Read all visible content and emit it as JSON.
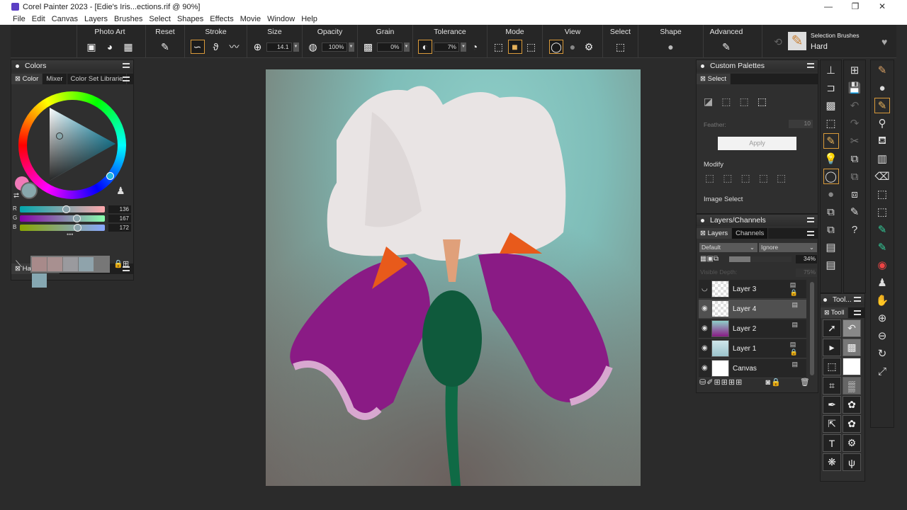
{
  "window": {
    "title": "Corel Painter 2023 - [Edie's Iris...ections.rif @ 90%]",
    "controls": [
      "minimize",
      "maximize",
      "close"
    ]
  },
  "menu": [
    "File",
    "Edit",
    "Canvas",
    "Layers",
    "Brushes",
    "Select",
    "Shapes",
    "Effects",
    "Movie",
    "Window",
    "Help"
  ],
  "toolbar": {
    "photo_art": "Photo Art",
    "reset": "Reset",
    "stroke": "Stroke",
    "size": "Size",
    "size_value": "14.1",
    "opacity": "Opacity",
    "opacity_value": "100%",
    "grain": "Grain",
    "grain_value": "0%",
    "tolerance": "Tolerance",
    "tolerance_value": "7%",
    "mode": "Mode",
    "view": "View",
    "select": "Select",
    "shape": "Shape",
    "advanced": "Advanced",
    "brush_category": "Selection Brushes",
    "brush_variant": "Hard"
  },
  "colors_panel": {
    "title": "Colors",
    "tabs": [
      "Color",
      "Mixer",
      "Color Set Librarie"
    ],
    "main_color": "#88a7ac",
    "secondary_color": "#f07ab8",
    "rgb": {
      "r_label": "R",
      "g_label": "G",
      "b_label": "B",
      "r": "136",
      "g": "167",
      "b": "172"
    },
    "harmonies_title": "Harmonies",
    "harmony_swatches": [
      "#a88a8a",
      "#a89090",
      "#9a9a9e",
      "#8fa3ab",
      "#86a8b2"
    ]
  },
  "custom_palettes": {
    "title": "Custom Palettes",
    "tab": "Select",
    "feather_label": "Feather:",
    "feather_value": "10",
    "apply": "Apply",
    "modify": "Modify",
    "image_select": "Image Select"
  },
  "layers_panel": {
    "title": "Layers/Channels",
    "tabs": [
      "Layers",
      "Channels"
    ],
    "composite_method": "Default",
    "preserve": "Ignore",
    "opacity": "34%",
    "visible_depth_label": "Visible Depth:",
    "visible_depth": "75%",
    "layers": [
      {
        "name": "Layer 3",
        "visible": false,
        "locked": true
      },
      {
        "name": "Layer 4",
        "visible": true,
        "locked": false,
        "selected": true
      },
      {
        "name": "Layer 2",
        "visible": true,
        "locked": false
      },
      {
        "name": "Layer 1",
        "visible": true,
        "locked": true
      },
      {
        "name": "Canvas",
        "visible": true,
        "locked": false
      }
    ]
  },
  "tools_panel": {
    "title": "Tool...",
    "tab": "Tooll"
  }
}
